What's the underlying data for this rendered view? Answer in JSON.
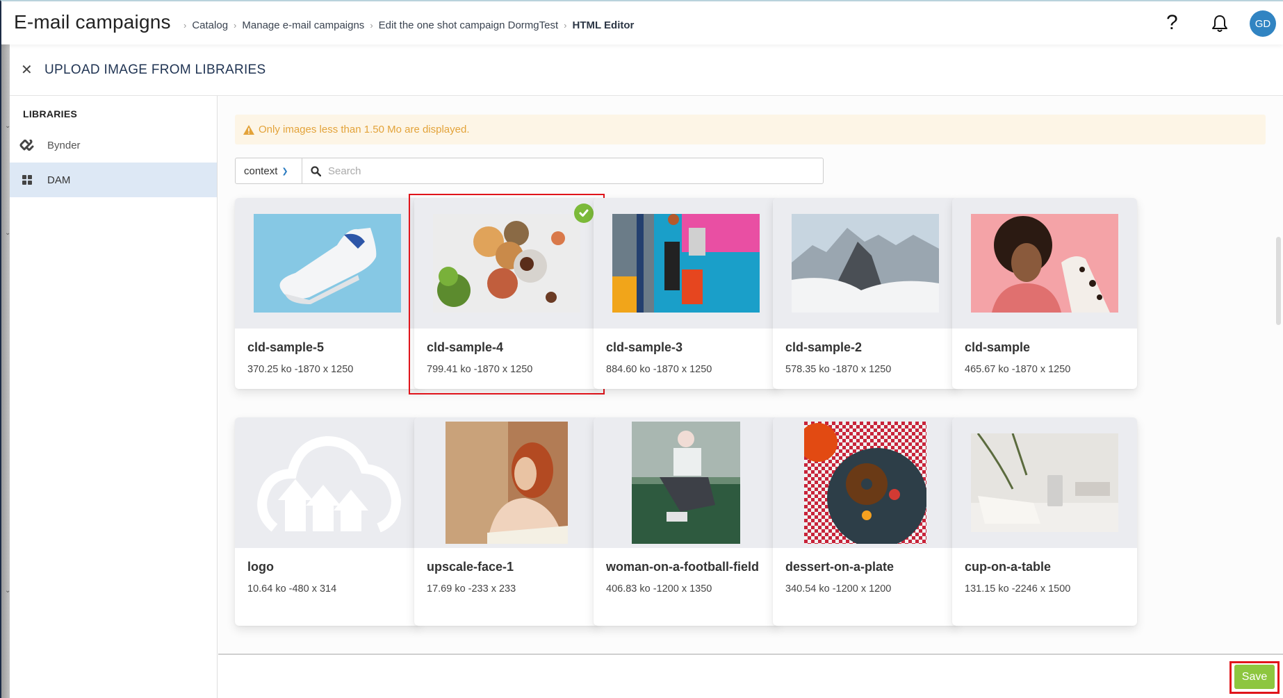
{
  "header": {
    "app_title": "E-mail campaigns",
    "breadcrumb": [
      {
        "label": "Catalog",
        "current": false
      },
      {
        "label": "Manage e-mail campaigns",
        "current": false
      },
      {
        "label": "Edit the one shot campaign DormgTest",
        "current": false
      },
      {
        "label": "HTML Editor",
        "current": true
      }
    ],
    "help_icon": "question-mark-icon",
    "notifications_icon": "bell-icon",
    "avatar_initials": "GD",
    "avatar_color": "#3184c2"
  },
  "modal": {
    "title": "UPLOAD IMAGE FROM LIBRARIES",
    "close_icon": "close-icon"
  },
  "sidebar": {
    "heading": "LIBRARIES",
    "items": [
      {
        "label": "Bynder",
        "icon": "bynder-icon",
        "active": false
      },
      {
        "label": "DAM",
        "icon": "grid-icon",
        "active": true
      }
    ]
  },
  "banner": {
    "icon": "warning-icon",
    "text": "Only images less than 1.50 Mo are displayed.",
    "color": "#e3a33a"
  },
  "search": {
    "context_value": "context",
    "placeholder": "Search",
    "value": ""
  },
  "assets": [
    {
      "name": "cld-sample-5",
      "meta": "370.25 ko -1870 x 1250",
      "selected": false,
      "thumb": "shoe"
    },
    {
      "name": "cld-sample-4",
      "meta": "799.41 ko -1870 x 1250",
      "selected": true,
      "thumb": "food"
    },
    {
      "name": "cld-sample-3",
      "meta": "884.60 ko -1870 x 1250",
      "selected": false,
      "thumb": "basketball"
    },
    {
      "name": "cld-sample-2",
      "meta": "578.35 ko -1870 x 1250",
      "selected": false,
      "thumb": "mountain"
    },
    {
      "name": "cld-sample",
      "meta": "465.67 ko -1870 x 1250",
      "selected": false,
      "thumb": "woman-dog"
    },
    {
      "name": "logo",
      "meta": "10.64 ko -480 x 314",
      "selected": false,
      "thumb": "cloud-logo"
    },
    {
      "name": "upscale-face-1",
      "meta": "17.69 ko -233 x 233",
      "selected": false,
      "thumb": "face"
    },
    {
      "name": "woman-on-a-football-field",
      "meta": "406.83 ko -1200 x 1350",
      "selected": false,
      "thumb": "football"
    },
    {
      "name": "dessert-on-a-plate",
      "meta": "340.54 ko -1200 x 1200",
      "selected": false,
      "thumb": "dessert"
    },
    {
      "name": "cup-on-a-table",
      "meta": "131.15 ko -2246 x 1500",
      "selected": false,
      "thumb": "cup"
    }
  ],
  "footer": {
    "save_label": "Save",
    "save_color": "#8dc63f"
  },
  "highlight_color": "#e0141b"
}
